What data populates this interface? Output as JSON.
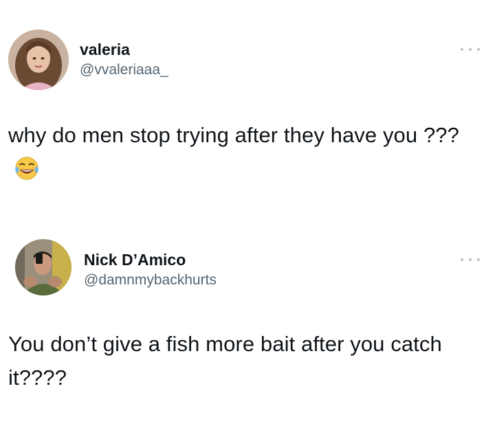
{
  "tweets": [
    {
      "display_name": "valeria",
      "handle": "@vvaleriaaa_",
      "text": "why do men stop trying after they have you ???",
      "emoji": "face-with-tears-of-joy-icon"
    },
    {
      "display_name": "Nick D’Amico",
      "handle": "@damnmybackhurts",
      "text": "You don’t give a fish more bait after you catch it????"
    }
  ],
  "colors": {
    "text": "#0f1419",
    "secondary": "#536471",
    "more_dots": "#b9c2ca"
  }
}
